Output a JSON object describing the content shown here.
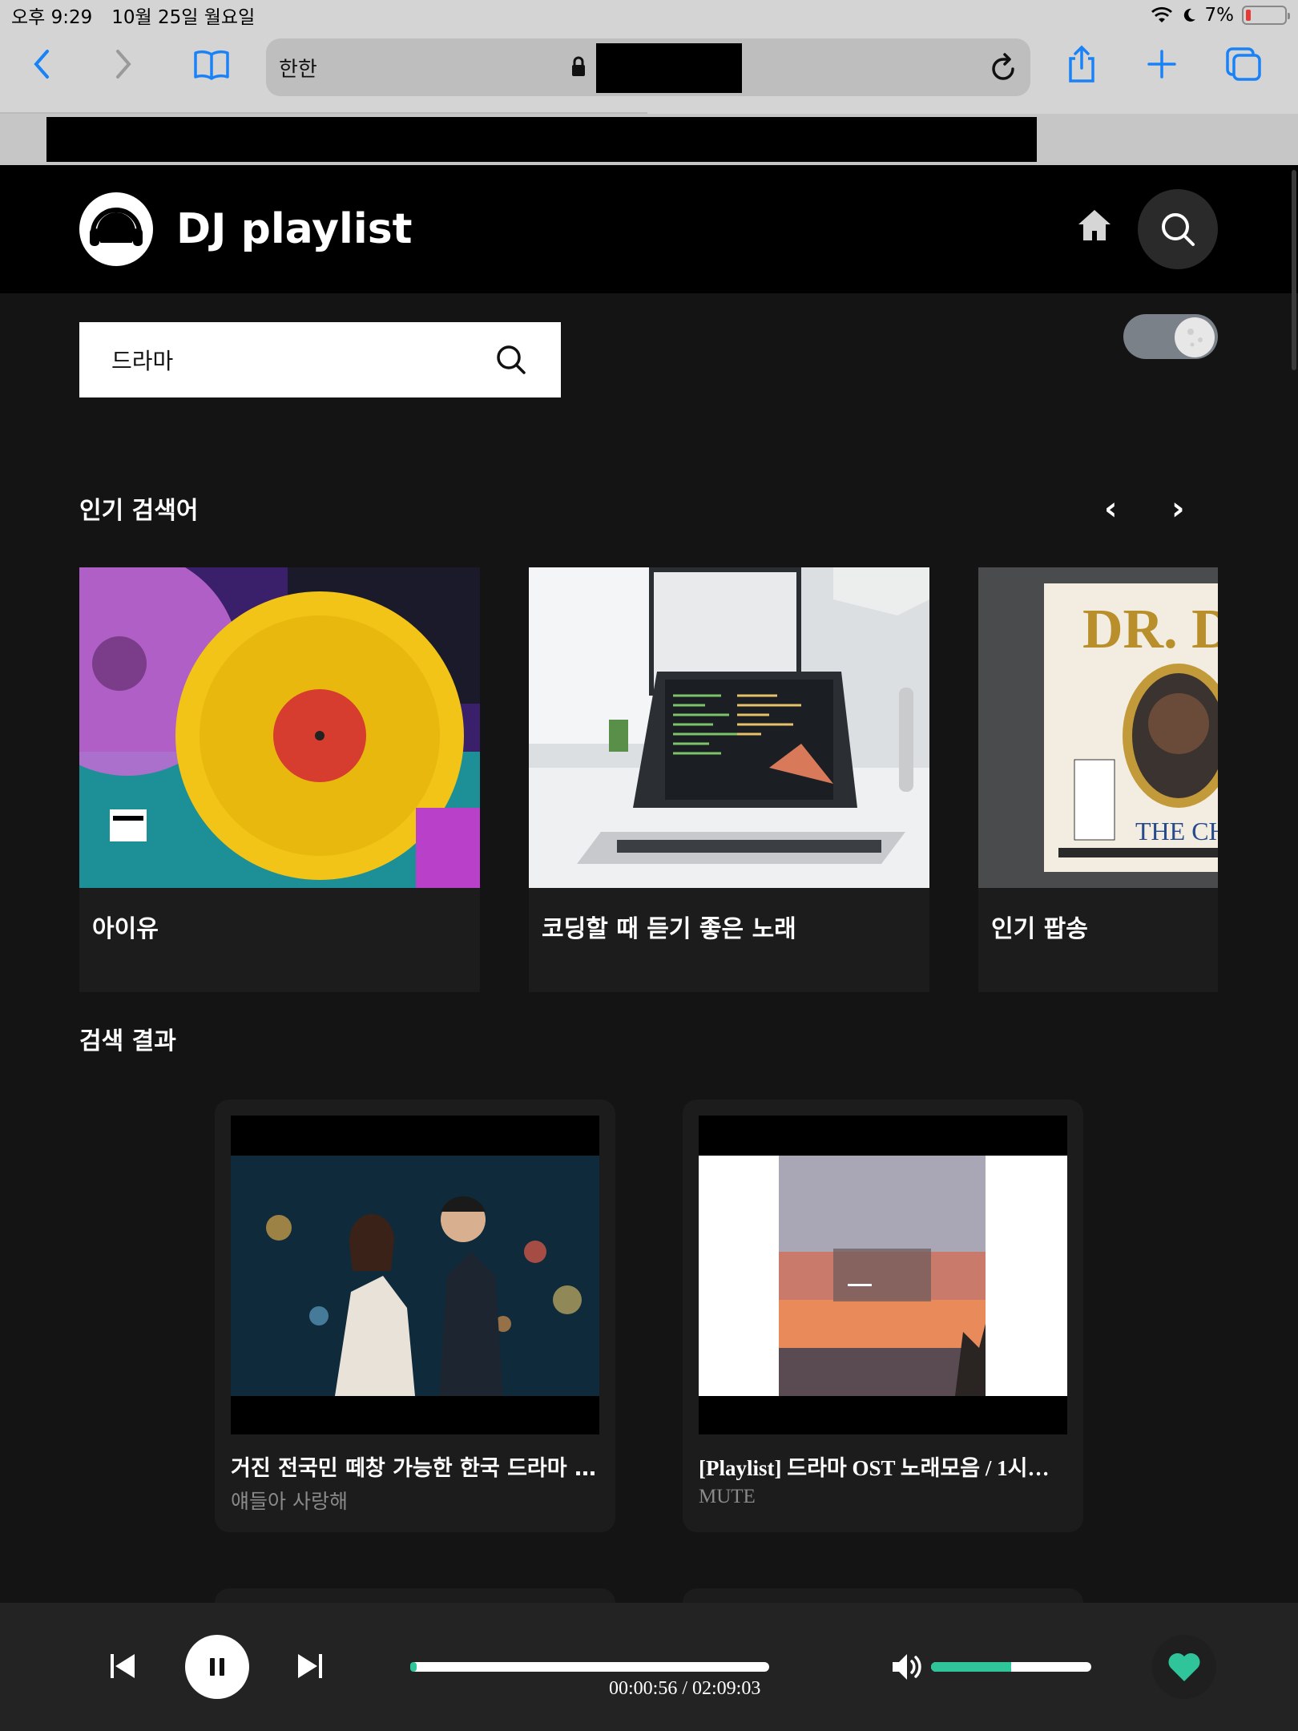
{
  "status_bar": {
    "time": "오후 9:29",
    "date": "10월 25일 월요일",
    "battery": "7%"
  },
  "browser": {
    "url_text": "한한"
  },
  "header": {
    "title": "DJ playlist"
  },
  "search": {
    "query": "드라마"
  },
  "popular": {
    "title": "인기 검색어",
    "prev": "‹",
    "next": "›",
    "items": [
      {
        "label": "아이유"
      },
      {
        "label": "코딩할 때 듣기 좋은 노래"
      },
      {
        "label": "인기 팝송"
      }
    ]
  },
  "results": {
    "title": "검색 결과",
    "items": [
      {
        "title": "거진 전국민 떼창 가능한 한국 드라마 os…",
        "channel": "얘들아 사랑해"
      },
      {
        "title": "[Playlist] 드라마 OST 노래모음 / 1시…",
        "channel": "MUTE"
      }
    ]
  },
  "player": {
    "time": "00:00:56 / 02:09:03",
    "progress_fraction": 0.007,
    "volume_fraction": 0.5
  },
  "colors": {
    "accent": "#2fc49a",
    "background": "#141414",
    "header": "#000000"
  }
}
